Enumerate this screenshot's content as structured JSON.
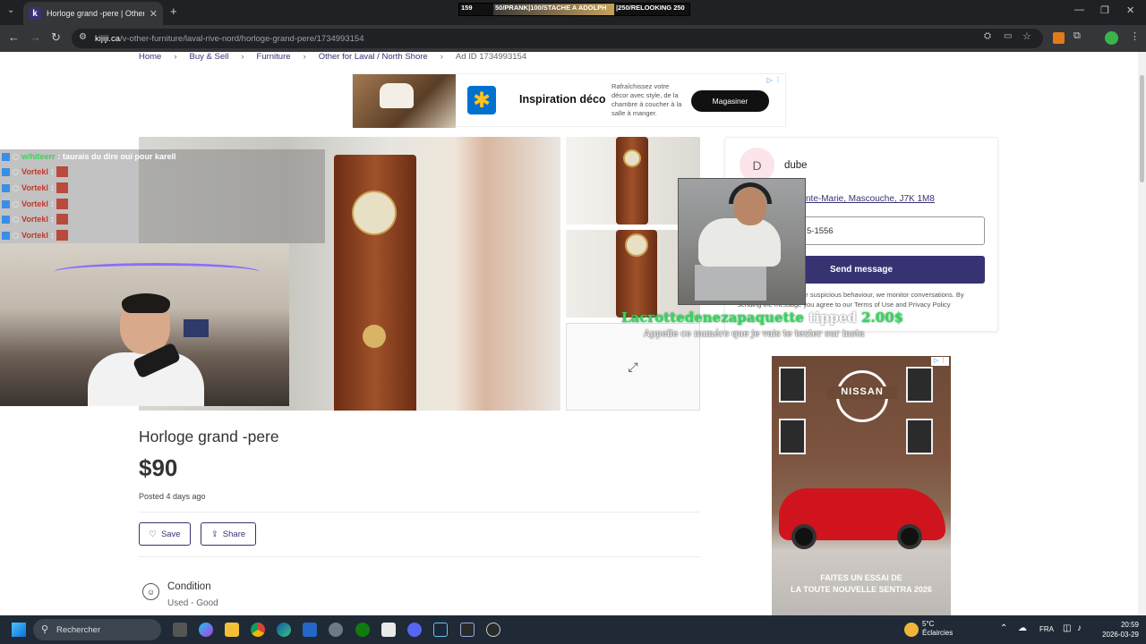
{
  "browser": {
    "tab_title": "Horloge grand -pere | Other | L",
    "tab_favicon": "k",
    "url_host": "kijiji.ca",
    "url_path": "/v-other-furniture/laval-rive-nord/horloge-grand-pere/1734993154"
  },
  "stream_banner": {
    "seg1": "159",
    "seg2": "50/PRANK|100/STACHE A ADOLPH",
    "seg3": "|250/RELOOKING 250"
  },
  "breadcrumb": {
    "items": [
      "Home",
      "Buy & Sell",
      "Furniture",
      "Other for Laval / North Shore"
    ],
    "ad_id": "Ad ID 1734993154"
  },
  "ad_top": {
    "headline": "Inspiration déco",
    "description": "Rafraîchissez votre décor avec style, de la chambre à coucher à la salle à manger.",
    "button": "Magasiner"
  },
  "listing": {
    "title": "Horloge grand -pere",
    "price": "$90",
    "posted": "Posted 4 days ago",
    "save_label": "Save",
    "share_label": "Share",
    "condition_label": "Condition",
    "condition_value": "Used - Good"
  },
  "seller": {
    "avatar_letter": "D",
    "name": "dube",
    "address": "nte-Marie, Mascouche, J7K 1M8",
    "phone": "5-1556",
    "send_label": "Send message",
    "disclaimer": "potential fraud, spam or suspicious behaviour, we monitor conversations. By sending the message you agree to our Terms of Use and Privacy Policy"
  },
  "ad_side": {
    "brand": "NISSAN",
    "line1": "FAITES UN ESSAI DE",
    "line2": "LA TOUTE NOUVELLE SENTRA 2026"
  },
  "chat": {
    "first": {
      "user": "w/hiteerr",
      "text": ": taurais du dire oui pour karell"
    },
    "repeats": [
      "Vortekl",
      "Vortekl",
      "Vortekl",
      "Vortekl",
      "Vortekl"
    ],
    "repeat_sep": ":"
  },
  "tip": {
    "user": "Lacrottedenezapaquette",
    "verb": "tipped",
    "amount": "2.00$",
    "message": "Appelle ce numéro que je vais te texter sur insta"
  },
  "taskbar": {
    "search_placeholder": "Rechercher",
    "temp": "5°C",
    "weather": "Éclaircies",
    "lang": "FRA",
    "time": "20:59",
    "date": "2026-03-29"
  },
  "colors": {
    "brand": "#373373",
    "tip_green": "#3bd35c"
  }
}
